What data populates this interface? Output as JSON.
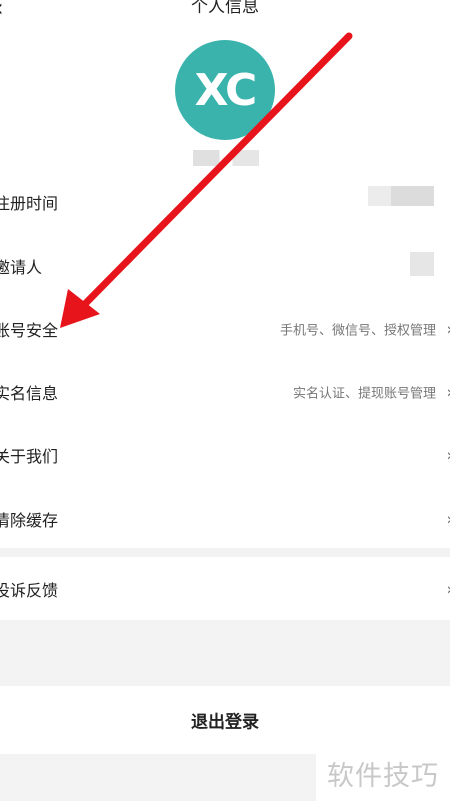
{
  "header": {
    "title": "个人信息",
    "back_icon": "‹"
  },
  "profile": {
    "avatar_text": "XC",
    "avatar_color": "#3ab3ad"
  },
  "rows": [
    {
      "label": "注册时间",
      "value": ""
    },
    {
      "label": "邀请人",
      "value": ""
    },
    {
      "label": "账号安全",
      "value": "手机号、微信号、授权管理",
      "chevron": "›"
    },
    {
      "label": "实名信息",
      "value": "实名认证、提现账号管理",
      "chevron": "›"
    },
    {
      "label": "关于我们",
      "value": "",
      "chevron": "›"
    },
    {
      "label": "清除缓存",
      "value": "",
      "chevron": "›"
    },
    {
      "label": "投诉反馈",
      "value": "",
      "chevron": "›"
    }
  ],
  "logout": {
    "label": "退出登录"
  },
  "watermark": {
    "text": "软件技巧"
  },
  "annotation": {
    "arrow_color": "#e8141b"
  }
}
